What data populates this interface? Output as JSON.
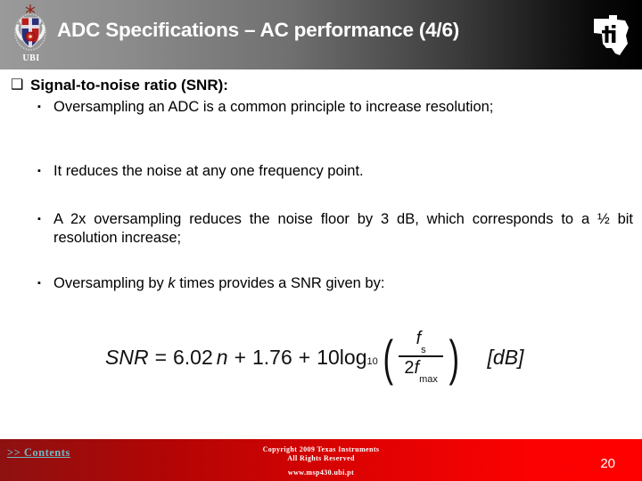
{
  "header": {
    "title": "ADC Specifications – AC performance (4/6)",
    "university_logo_caption": "UBI",
    "ti_logo_name": "texas-instruments-logo"
  },
  "content": {
    "heading": {
      "marker": "❑",
      "text": "Signal-to-noise ratio (SNR):"
    },
    "bullets": [
      {
        "marker": "▪",
        "text": "Oversampling an ADC is a common principle to increase resolution;"
      },
      {
        "marker": "▪",
        "text": "It reduces the noise at any one frequency point."
      },
      {
        "marker": "▪",
        "text": "A 2x oversampling reduces the noise floor by 3 dB, which corresponds to a ½ bit resolution increase;"
      },
      {
        "marker": "▪",
        "text_before_italic": "Oversampling by ",
        "italic_symbol": "k",
        "text_after_italic": " times provides a SNR given by:"
      }
    ],
    "formula": {
      "lhs": "SNR",
      "equals": "=",
      "term1_coefficient": "6.02",
      "term1_variable": "n",
      "plus1": "+",
      "term2": "1.76",
      "plus2": "+",
      "log_coefficient": "10",
      "log_name": "log",
      "log_base": "10",
      "fraction_numerator_var": "f",
      "fraction_numerator_sub": "s",
      "fraction_denominator_coefficient": "2",
      "fraction_denominator_var": "f",
      "fraction_denominator_sub": "max",
      "units": "[dB]",
      "plain_text": "SNR = 6.02 n + 1.76 + 10 log10( fs / 2 fmax ) [dB]"
    }
  },
  "footer": {
    "contents_link": ">> Contents",
    "copyright_line1": "Copyright  2009 Texas Instruments",
    "copyright_line2": "All Rights Reserved",
    "website": "www.msp430.ubi.pt",
    "page_number": "20"
  },
  "colors": {
    "header_gradient_start": "#9a9a9a",
    "header_gradient_end": "#000000",
    "footer_gradient_start": "#8e1111",
    "footer_gradient_end": "#ff0000",
    "body_background": "#ffffff",
    "text": "#000000",
    "link": "#74b6c4"
  }
}
